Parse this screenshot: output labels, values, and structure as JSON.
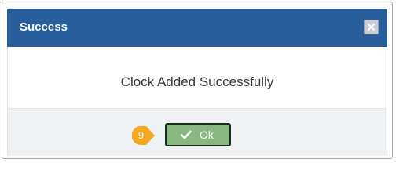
{
  "dialog": {
    "title": "Success",
    "message": "Clock Added Successfully",
    "close_icon": "close-icon",
    "ok_label": "Ok",
    "ok_icon": "check-icon",
    "step_marker": "9"
  },
  "colors": {
    "header": "#2a5d9b",
    "footer": "#eef1f6",
    "ok_button": "#87b87f",
    "step_marker": "#f5a623"
  }
}
